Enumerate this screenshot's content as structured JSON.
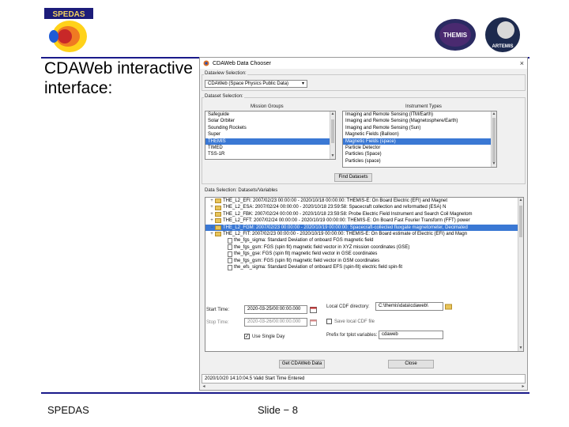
{
  "slide": {
    "heading": "CDAWeb interactive interface:",
    "footer_left": "SPEDAS",
    "footer_center": "Slide − 8",
    "logo_text": "SPEDAS",
    "logo_right_texts": [
      "THEMIS",
      "ARTEMIS"
    ]
  },
  "window": {
    "title": "CDAWeb Data Chooser",
    "close_symbol": "×",
    "dataview_group": "Dataview Selection:",
    "dataview_value": "CDAWeb (Space Physics Public Data)",
    "dataset_group": "Dataset Selection:",
    "mission_header": "Mission Groups",
    "instrument_header": "Instrument Types",
    "missions": [
      "Safeguide",
      "Solar Orbiter",
      "Sounding Rockets",
      "Super",
      "THEMIS",
      "TIMED",
      "TSS-1R"
    ],
    "instruments": [
      "Imaging and Remote Sensing (ITM/Earth)",
      "Imaging and Remote Sensing (Magnetosphere/Earth)",
      "Imaging and Remote Sensing (Sun)",
      "Magnetic Fields (Balloon)",
      "Magnetic Fields (space)",
      "Particle Detector",
      "Particles (Space)",
      "Particles (space)"
    ],
    "find_datasets": "Find Datasets",
    "data_group": "Data Selection: Datasets/Variables",
    "tree_rows": [
      {
        "text": "THE_L2_EFI: 2007/02/23 00:00:00 - 2020/10/18 00:00:00: THEMIS-E: On Board Electric (EFI) and Magnet",
        "type": "folder",
        "indent": 0
      },
      {
        "text": "THE_L2_ESA: 2007/02/24 00:00:00 - 2020/10/18 23:59:58: Spacecraft collection and reformatted (ESA) N",
        "type": "folder",
        "indent": 0
      },
      {
        "text": "THE_L2_FBK: 2007/02/24 00:00:00 - 2020/10/18 23:59:58: Probe Electric Field Instrument and Search Coil Magnetom",
        "type": "folder",
        "indent": 0
      },
      {
        "text": "THE_L2_FFT: 2007/02/24 00:00:00 - 2020/10/19 00:00:00: THEMIS-E: On Board Fast Fourier Transform (FFT) power",
        "type": "folder",
        "indent": 0
      },
      {
        "text": "THE_L2_FGM: 2007/02/23 00:00:00 - 2020/10/19 00:00:00: Spacecraft-collected fluxgate magnetometer, Decimated",
        "type": "folder",
        "indent": 0,
        "selected": true
      },
      {
        "text": "THE_L2_FIT: 2007/02/23 00:00:00 - 2020/10/19 00:00:00: THEMIS-E: On Board estimate of Electric (EFI) and Magn",
        "type": "folder",
        "indent": 0
      },
      {
        "text": "the_fgs_sigma: Standard Deviation of onboard FGS magnetic field",
        "type": "doc",
        "indent": 1
      },
      {
        "text": "the_fgs_gsm: FGS (spin fit) magnetic field vector in XYZ mission coordinates (GSE)",
        "type": "doc",
        "indent": 1
      },
      {
        "text": "the_fgs_gse: FGS (spin fit) magnetic field vector in GSE coordinates",
        "type": "doc",
        "indent": 1
      },
      {
        "text": "the_fgs_gsm: FGS (spin fit) magnetic field vector in GSM coordinates",
        "type": "doc",
        "indent": 1
      },
      {
        "text": "the_efs_sigma: Standard Deviation of onboard EFS (spin-fit) electric field spin-fit",
        "type": "doc",
        "indent": 1
      }
    ],
    "start_label": "Start Time:",
    "start_value": "2020-03-25/00:00:00.000",
    "stop_label": "Stop Time:",
    "stop_value": "2020-03-26/00:00:00.000",
    "local_dir_label": "Local CDF directory:",
    "local_dir_value": "C:\\themis\\data\\cdaweb\\",
    "save_local_label": "Save local CDF file",
    "use_single_day_label": "Use Single Day",
    "use_single_day_check": "✓",
    "prefix_label": "Prefix for tplot variables:",
    "prefix_value": "cdaweb",
    "get_btn": "Get CDAWeb Data",
    "close_btn": "Close",
    "status_text": "2020/10/20 14:10:04.5 Valid Start Time Entered",
    "icon_colors": {
      "folder": "#e8c45a",
      "selection": "#3a78d4"
    }
  }
}
